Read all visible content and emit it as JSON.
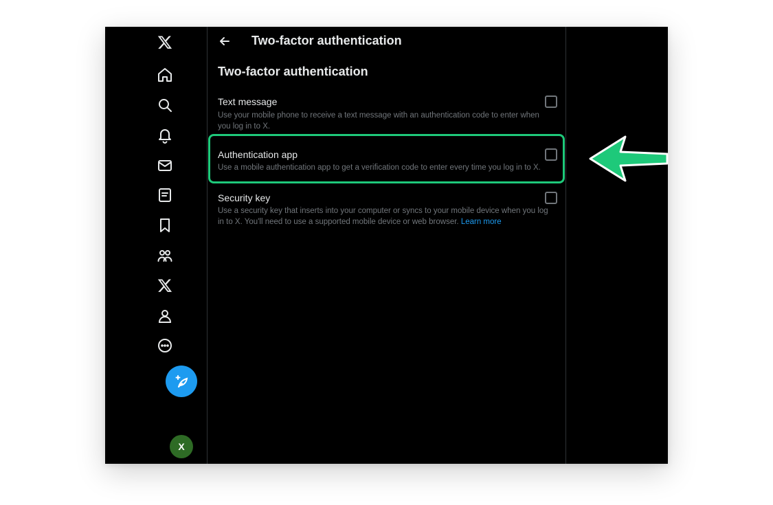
{
  "sidebar": {
    "items": [
      {
        "name": "x-logo-icon"
      },
      {
        "name": "home-icon"
      },
      {
        "name": "search-icon"
      },
      {
        "name": "notifications-icon"
      },
      {
        "name": "messages-icon"
      },
      {
        "name": "lists-icon"
      },
      {
        "name": "bookmarks-icon"
      },
      {
        "name": "communities-icon"
      },
      {
        "name": "premium-icon"
      },
      {
        "name": "profile-icon"
      },
      {
        "name": "more-icon"
      }
    ],
    "avatar_initial": "X"
  },
  "header": {
    "title": "Two-factor authentication"
  },
  "main": {
    "section_title": "Two-factor authentication",
    "options": [
      {
        "label": "Text message",
        "description": "Use your mobile phone to receive a text message with an authentication code to enter when you log in to X.",
        "checked": false
      },
      {
        "label": "Authentication app",
        "description": "Use a mobile authentication app to get a verification code to enter every time you log in to X.",
        "checked": false
      },
      {
        "label": "Security key",
        "description": "Use a security key that inserts into your computer or syncs to your mobile device when you log in to X. You'll need to use a supported mobile device or web browser.",
        "link": "Learn more",
        "checked": false
      }
    ]
  },
  "colors": {
    "accent": "#1d9bf0",
    "highlight": "#1ec97a",
    "avatar": "#2e6b25"
  }
}
